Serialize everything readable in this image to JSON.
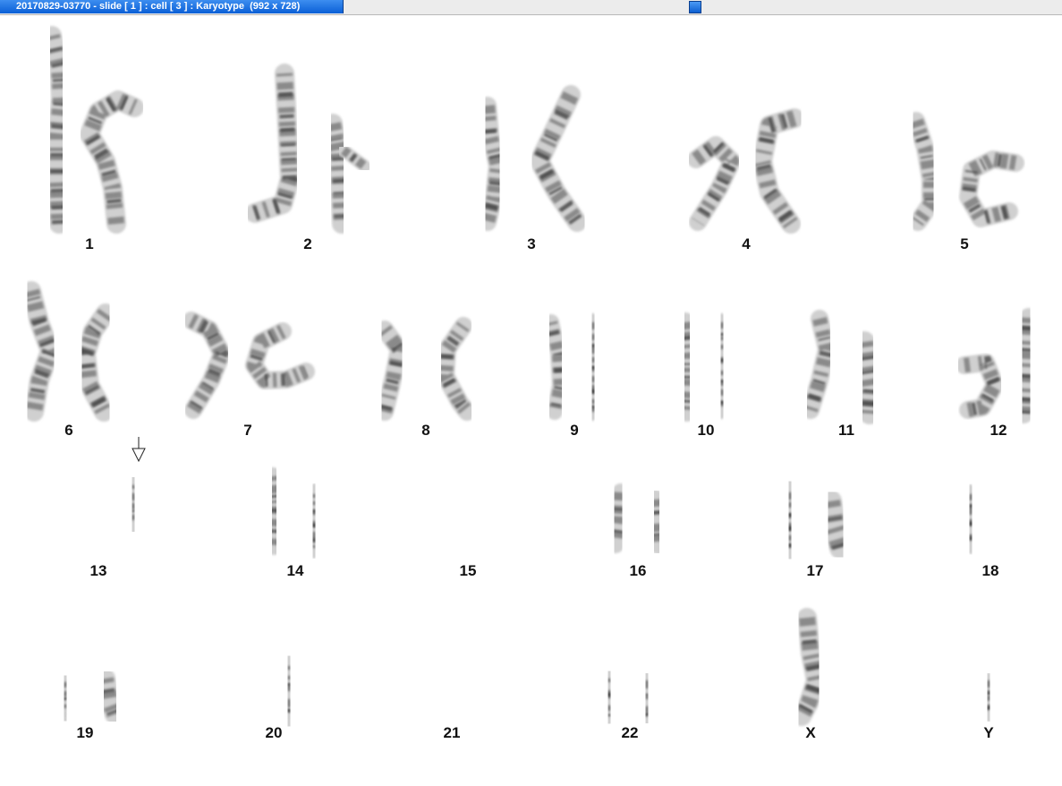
{
  "window": {
    "title": "20170829-03770 - slide [ 1 ] : cell [ 3 ] : Karyotype  (992 x 728)"
  },
  "karyotype": {
    "chromosome_labels": [
      "1",
      "2",
      "3",
      "4",
      "5",
      "6",
      "7",
      "8",
      "9",
      "10",
      "11",
      "12",
      "13",
      "14",
      "15",
      "16",
      "17",
      "18",
      "19",
      "20",
      "21",
      "22",
      "X",
      "Y"
    ],
    "marker": {
      "icon": "arrow-down-outline-icon",
      "chromosome": "13"
    },
    "colors": {
      "stain_dark": "#3c3c3c",
      "stain_mid": "#8a8a8a",
      "stain_light": "#d0d0d0"
    }
  }
}
